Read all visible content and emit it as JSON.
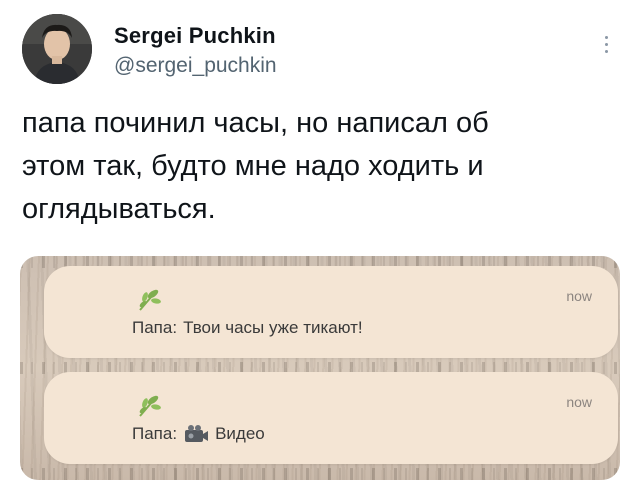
{
  "author": {
    "display_name": "Sergei Puchkin",
    "handle": "@sergei_puchkin"
  },
  "tweet": {
    "line1": "папа починил часы, но написал об",
    "line2": "этом так, будто мне надо ходить и",
    "line3": "оглядываться."
  },
  "notifications": [
    {
      "time": "now",
      "sender": "Папа:",
      "text": "Твои часы уже тикают!",
      "app_icon": "leaf-icon"
    },
    {
      "time": "now",
      "sender": "Папа:",
      "text": "Видео",
      "app_icon": "leaf-icon",
      "attachment_icon": "video-camera-icon"
    }
  ],
  "colors": {
    "notification_bg": "#f4e5d4",
    "handle_gray": "#536471",
    "leaf_green": "#7fae4f"
  }
}
